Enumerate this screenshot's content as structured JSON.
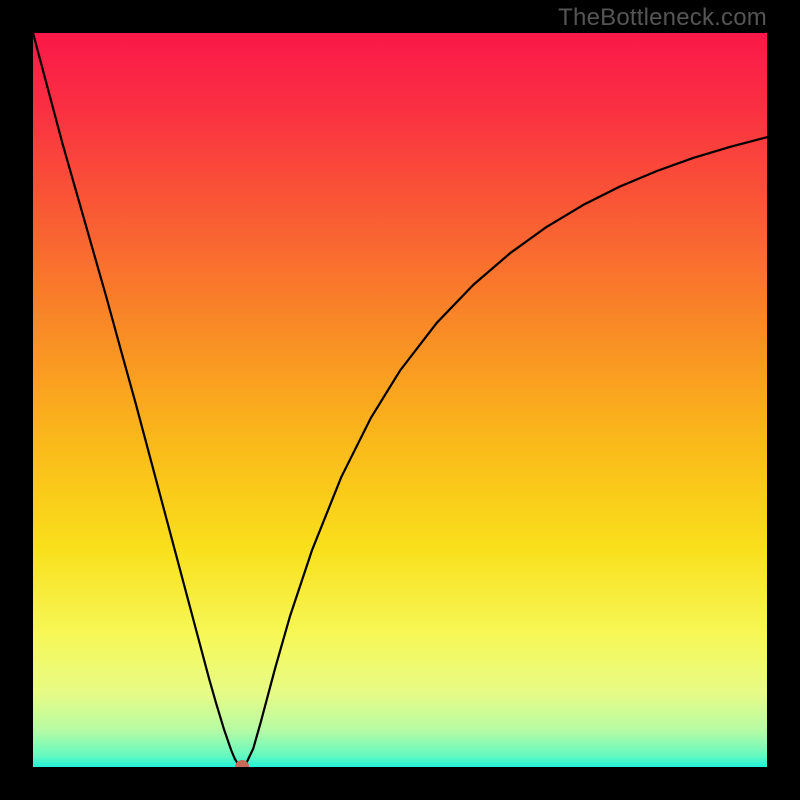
{
  "watermark": "TheBottleneck.com",
  "chart_data": {
    "type": "line",
    "title": "",
    "xlabel": "",
    "ylabel": "",
    "xlim": [
      0,
      100
    ],
    "ylim": [
      0,
      100
    ],
    "grid": false,
    "legend": false,
    "background_gradient": {
      "stops": [
        {
          "offset": 0.0,
          "color": "#fa1848"
        },
        {
          "offset": 0.1,
          "color": "#fa2f42"
        },
        {
          "offset": 0.25,
          "color": "#f95c34"
        },
        {
          "offset": 0.4,
          "color": "#f98a26"
        },
        {
          "offset": 0.55,
          "color": "#fab71a"
        },
        {
          "offset": 0.7,
          "color": "#f9df1b"
        },
        {
          "offset": 0.82,
          "color": "#f6f857"
        },
        {
          "offset": 0.9,
          "color": "#e7fb86"
        },
        {
          "offset": 0.95,
          "color": "#b6fba4"
        },
        {
          "offset": 0.985,
          "color": "#63f9c1"
        },
        {
          "offset": 1.0,
          "color": "#21f2d7"
        }
      ]
    },
    "series": [
      {
        "name": "bottleneck-curve",
        "color": "#000000",
        "stroke_width": 2.2,
        "x": [
          0,
          2,
          4,
          6,
          8,
          10,
          12,
          14,
          16,
          18,
          20,
          22,
          24,
          25,
          26,
          27,
          27.5,
          28,
          28.3,
          28.7,
          29,
          30,
          31,
          33,
          35,
          38,
          42,
          46,
          50,
          55,
          60,
          65,
          70,
          75,
          80,
          85,
          90,
          95,
          100
        ],
        "y": [
          100,
          92.5,
          85,
          78,
          71,
          64,
          56.7,
          49.5,
          42,
          34.5,
          27,
          19.5,
          12,
          8.5,
          5.2,
          2.3,
          1.1,
          0.3,
          0.0,
          0.0,
          0.4,
          2.5,
          6.0,
          13.5,
          20.5,
          29.5,
          39.5,
          47.5,
          54.0,
          60.5,
          65.7,
          70.0,
          73.6,
          76.6,
          79.1,
          81.2,
          83.0,
          84.5,
          85.8
        ]
      }
    ],
    "marker": {
      "name": "optimal-point",
      "x": 28.5,
      "y": 0.0,
      "color": "#c76a5a",
      "radius_px": 7
    }
  }
}
